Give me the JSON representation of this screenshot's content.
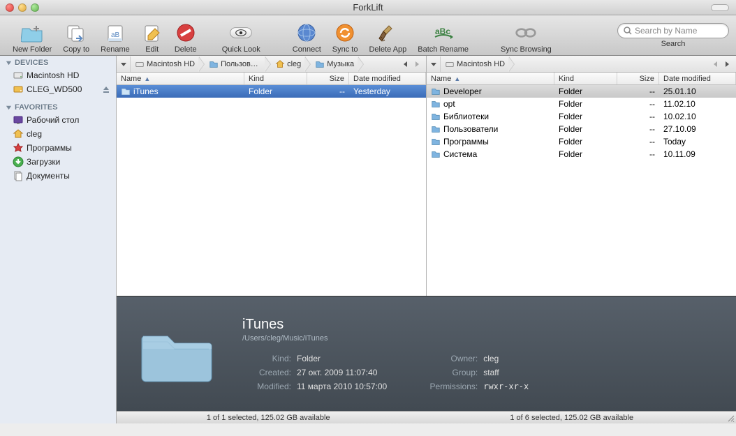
{
  "window": {
    "title": "ForkLift"
  },
  "toolbar": {
    "items": [
      "New Folder",
      "Copy to",
      "Rename",
      "Edit",
      "Delete",
      "Quick Look",
      "Connect",
      "Sync to",
      "Delete App",
      "Batch Rename",
      "Sync Browsing"
    ],
    "search_placeholder": "Search by Name",
    "search_label": "Search"
  },
  "sidebar": {
    "devices_header": "DEVICES",
    "devices": [
      {
        "label": "Macintosh HD",
        "eject": false
      },
      {
        "label": "CLEG_WD500",
        "eject": true
      }
    ],
    "favorites_header": "FAVORITES",
    "favorites": [
      {
        "label": "Рабочий стол"
      },
      {
        "label": "cleg"
      },
      {
        "label": "Программы"
      },
      {
        "label": "Загрузки"
      },
      {
        "label": "Документы"
      }
    ]
  },
  "left_pane": {
    "breadcrumbs": [
      "Macintosh HD",
      "Пользователи",
      "cleg",
      "Музыка"
    ],
    "columns": {
      "name": "Name",
      "kind": "Kind",
      "size": "Size",
      "date": "Date modified"
    },
    "rows": [
      {
        "name": "iTunes",
        "kind": "Folder",
        "size": "--",
        "date": "Yesterday",
        "selected": true
      }
    ]
  },
  "right_pane": {
    "breadcrumbs": [
      "Macintosh HD"
    ],
    "columns": {
      "name": "Name",
      "kind": "Kind",
      "size": "Size",
      "date": "Date modified"
    },
    "rows": [
      {
        "name": "Developer",
        "kind": "Folder",
        "size": "--",
        "date": "25.01.10",
        "selected": true
      },
      {
        "name": "opt",
        "kind": "Folder",
        "size": "--",
        "date": "11.02.10"
      },
      {
        "name": "Библиотеки",
        "kind": "Folder",
        "size": "--",
        "date": "10.02.10"
      },
      {
        "name": "Пользователи",
        "kind": "Folder",
        "size": "--",
        "date": "27.10.09"
      },
      {
        "name": "Программы",
        "kind": "Folder",
        "size": "--",
        "date": "Today"
      },
      {
        "name": "Система",
        "kind": "Folder",
        "size": "--",
        "date": "10.11.09"
      }
    ]
  },
  "info": {
    "title": "iTunes",
    "path": "/Users/cleg/Music/iTunes",
    "kind_label": "Kind:",
    "kind": "Folder",
    "created_label": "Created:",
    "created": "27 окт. 2009 11:07:40",
    "modified_label": "Modified:",
    "modified": "11 марта 2010 10:57:00",
    "owner_label": "Owner:",
    "owner": "cleg",
    "group_label": "Group:",
    "group": "staff",
    "perm_label": "Permissions:",
    "perm": "rwxr-xr-x"
  },
  "status": {
    "left": "1 of 1 selected, 125.02 GB available",
    "right": "1 of 6 selected, 125.02 GB available"
  }
}
